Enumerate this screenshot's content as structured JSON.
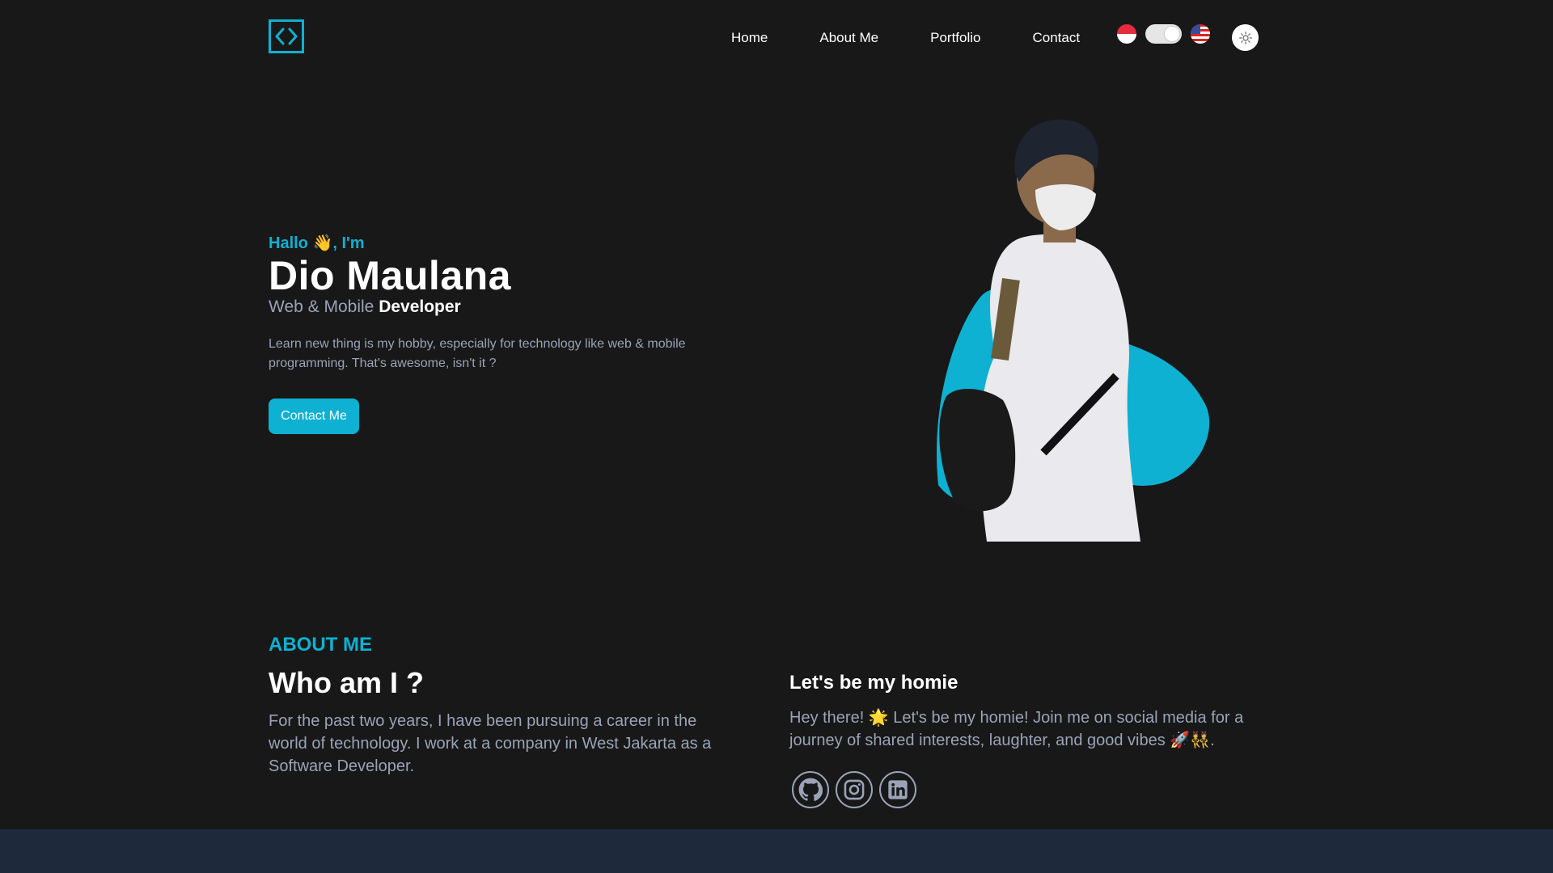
{
  "nav": {
    "links": [
      "Home",
      "About Me",
      "Portfolio",
      "Contact"
    ],
    "logo_icon": "code-brackets-icon",
    "language_flags": [
      "indonesia-flag-icon",
      "usa-flag-icon"
    ],
    "theme_icon": "sun-icon"
  },
  "hero": {
    "greeting": "Hallo 👋, I'm",
    "name": "Dio Maulana",
    "role_prefix": "Web & Mobile",
    "role_highlight": "Developer",
    "description": "Learn new thing is my hobby, especially for technology like web & mobile programming. That's awesome, isn't it ?",
    "cta_label": "Contact Me"
  },
  "about": {
    "label": "ABOUT ME",
    "title": "Who am I ?",
    "text": "For the past two years, I have been pursuing a career in the world of technology. I work at a company in West Jakarta as a Software Developer.",
    "homie_title": "Let's be my homie",
    "homie_text": "Hey there! 🌟 Let's be my homie! Join me on social media for a journey of shared interests, laughter, and good vibes 🚀👯.",
    "socials": [
      "github-icon",
      "instagram-icon",
      "linkedin-icon"
    ]
  },
  "colors": {
    "accent": "#0eb1d2",
    "background": "#181818",
    "muted_text": "#9aa3b8",
    "footer_band": "#1e293b"
  }
}
